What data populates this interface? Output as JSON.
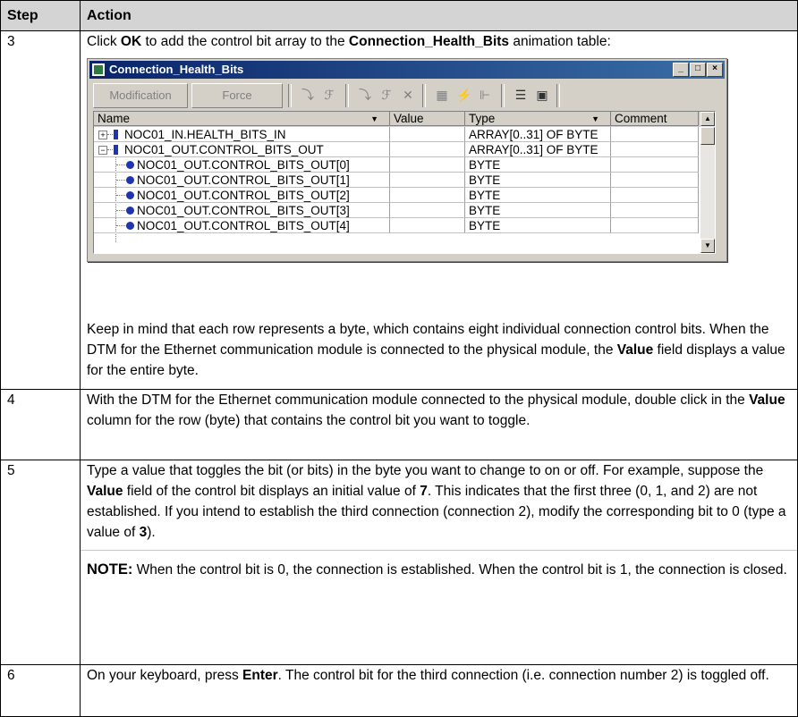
{
  "table": {
    "headers": [
      "Step",
      "Action"
    ],
    "rows": [
      {
        "step": "3",
        "action_intro": [
          "Click ",
          "OK",
          " to add the control bit array to the ",
          "Connection_Health_Bits",
          " animation table:"
        ],
        "action_after": [
          "Keep in mind that each row represents a byte, which contains eight individual connection control bits. When the DTM for the Ethernet communication module is connected to the physical module, the ",
          "Value",
          " field displays a value for the entire byte."
        ]
      },
      {
        "step": "4",
        "action": [
          "With the DTM for the Ethernet communication module connected to the physical module, double click in the ",
          "Value",
          " column for the row (byte) that contains the control bit you want to toggle."
        ]
      },
      {
        "step": "5",
        "action": [
          "Type a value that toggles the bit (or bits) in the byte you want to change to on or off. For example, suppose the ",
          "Value",
          " field of the control bit displays an initial value of ",
          "7",
          ". This indicates that the first three (0, 1, and 2) are not established. If you intend to establish the third connection (connection 2), modify the corresponding bit to 0 (type a value of ",
          "3",
          ")."
        ],
        "note_label": "NOTE:",
        "note_text": " When the control bit is 0, the connection is established. When the control bit is 1, the connection is closed."
      },
      {
        "step": "6",
        "action": [
          "On your keyboard, press ",
          "Enter",
          ". The control bit for the third connection (i.e. connection number 2) is toggled off."
        ]
      }
    ]
  },
  "window": {
    "title": "Connection_Health_Bits",
    "toolbar": {
      "modification_label": "Modification",
      "force_label": "Force"
    },
    "columns": [
      "Name",
      "Value",
      "Type",
      "Comment"
    ],
    "rows": [
      {
        "name": "NOC01_IN.HEALTH_BITS_IN",
        "value": "",
        "type": "ARRAY[0..31] OF BYTE",
        "comment": ""
      },
      {
        "name": "NOC01_OUT.CONTROL_BITS_OUT",
        "value": "",
        "type": "ARRAY[0..31] OF BYTE",
        "comment": ""
      },
      {
        "name": "NOC01_OUT.CONTROL_BITS_OUT[0]",
        "value": "",
        "type": "BYTE",
        "comment": ""
      },
      {
        "name": "NOC01_OUT.CONTROL_BITS_OUT[1]",
        "value": "",
        "type": "BYTE",
        "comment": ""
      },
      {
        "name": "NOC01_OUT.CONTROL_BITS_OUT[2]",
        "value": "",
        "type": "BYTE",
        "comment": ""
      },
      {
        "name": "NOC01_OUT.CONTROL_BITS_OUT[3]",
        "value": "",
        "type": "BYTE",
        "comment": ""
      },
      {
        "name": "NOC01_OUT.CONTROL_BITS_OUT[4]",
        "value": "",
        "type": "BYTE",
        "comment": ""
      }
    ]
  }
}
